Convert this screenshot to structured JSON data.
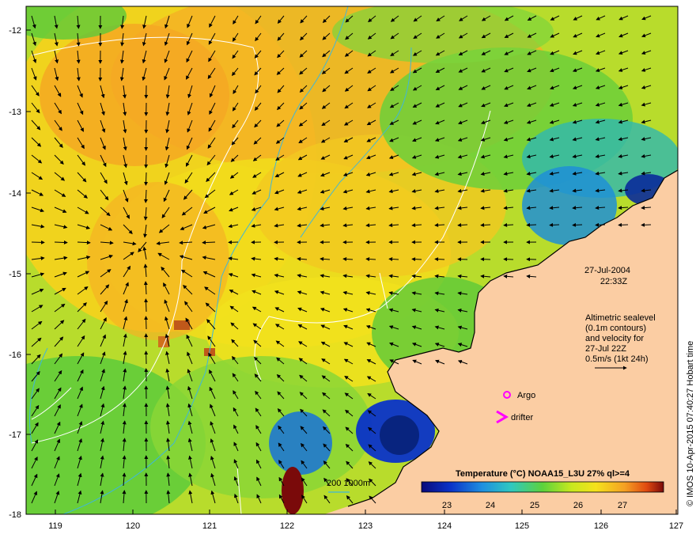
{
  "map": {
    "lat_labels": [
      "-12",
      "-13",
      "-14",
      "-15",
      "-16",
      "-17",
      "-18"
    ],
    "lon_labels": [
      "119",
      "120",
      "121",
      "122",
      "123",
      "124",
      "125",
      "126",
      "127"
    ],
    "date": "27-Jul-2004",
    "time": "22:33Z",
    "altimetry_lines": [
      "Altimetric sealevel",
      "(0.1m contours)",
      "and velocity for",
      "27-Jul 22Z",
      "0.5m/s (1kt 24h)"
    ],
    "argo_label": "Argo",
    "drifter_label": "drifter",
    "isobath_label": "200  1000m",
    "colorbar_title": "Temperature (°C) NOAA15_L3U 27% ql>=4",
    "colorbar_ticks": [
      "23",
      "24",
      "25",
      "26",
      "27"
    ],
    "credit": "© IMOS 10-Apr-2015 07:40:27 Hobart time",
    "colors": {
      "land": "#fbcda3",
      "warm": "#f5a623",
      "mid": "#f2e21c",
      "cool": "#5cc93a",
      "cold": "#1f8fd6",
      "coldest": "#08247f",
      "marker": "#ff00ff",
      "isobath": "#3fb7d8"
    }
  }
}
